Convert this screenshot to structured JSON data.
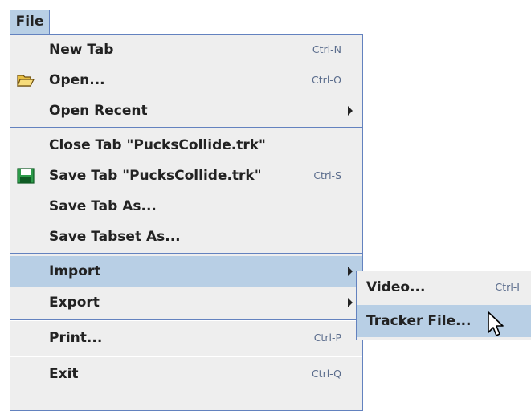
{
  "menubar": {
    "file_label": "File"
  },
  "file_menu": {
    "items": [
      {
        "label": "New Tab",
        "accel": "Ctrl-N"
      },
      {
        "label": "Open...",
        "accel": "Ctrl-O",
        "icon": "open-folder-icon"
      },
      {
        "label": "Open Recent",
        "submenu": true
      },
      {
        "label": "Close Tab \"PucksCollide.trk\""
      },
      {
        "label": "Save Tab \"PucksCollide.trk\"",
        "accel": "Ctrl-S",
        "icon": "floppy-disk-icon"
      },
      {
        "label": "Save Tab As..."
      },
      {
        "label": "Save Tabset As..."
      },
      {
        "label": "Import",
        "submenu": true,
        "selected": true
      },
      {
        "label": "Export",
        "submenu": true
      },
      {
        "label": "Print...",
        "accel": "Ctrl-P"
      },
      {
        "label": "Exit",
        "accel": "Ctrl-Q"
      }
    ]
  },
  "import_submenu": {
    "items": [
      {
        "label": "Video...",
        "accel": "Ctrl-I"
      },
      {
        "label": "Tracker File...",
        "selected": true
      }
    ]
  },
  "colors": {
    "selection": "#b8cfe5",
    "border": "#6382bf",
    "menu_background": "#eeeeee",
    "accelerator_text": "#5b6d8d"
  }
}
